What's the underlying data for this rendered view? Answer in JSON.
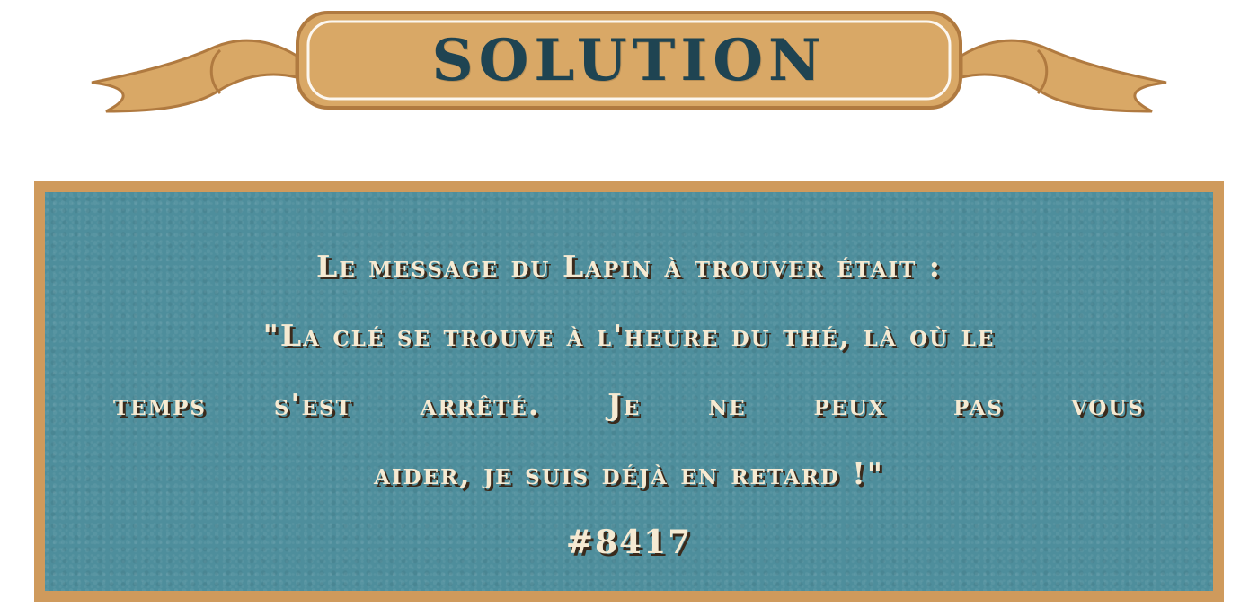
{
  "banner": {
    "title": "SOLUTION"
  },
  "solution": {
    "lines": [
      "Le message du Lapin à trouver était :",
      "\"La clé se trouve à l'heure du thé, là où le",
      "temps s'est arrêté. Je ne peux pas vous",
      "aider, je suis déjà en retard !\""
    ],
    "line3_words": [
      "temps",
      "s'est",
      "arrêté.",
      "Je",
      "ne",
      "peux",
      "pas",
      "vous"
    ],
    "code": "#8417"
  },
  "colors": {
    "banner_fill": "#d9a866",
    "banner_outline": "#b07a40",
    "title_text": "#1f4452",
    "panel_border": "#cf9a5c",
    "panel_bg": "#4e8e9c",
    "panel_text": "#f6ead2",
    "text_shadow": "#3a2a1c"
  }
}
